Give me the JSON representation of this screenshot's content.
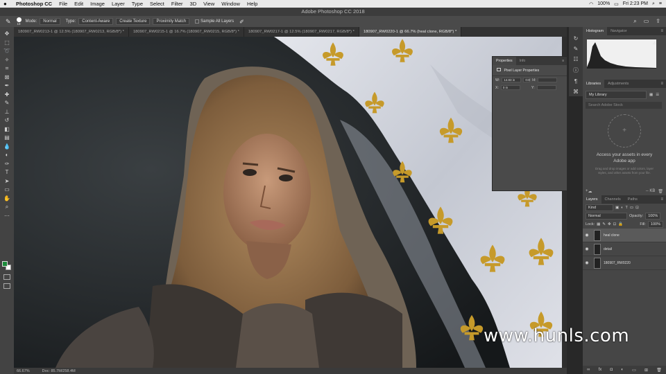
{
  "menubar": {
    "app": "Photoshop CC",
    "items": [
      "File",
      "Edit",
      "Image",
      "Layer",
      "Type",
      "Select",
      "Filter",
      "3D",
      "View",
      "Window",
      "Help"
    ],
    "battery": "100%",
    "clock": "Fri 2:23 PM"
  },
  "window_title": "Adobe Photoshop CC 2018",
  "options": {
    "brush_size": "19",
    "mode_label": "Mode:",
    "mode_value": "Normal",
    "type_label": "Type:",
    "type_buttons": [
      "Content-Aware",
      "Create Texture",
      "Proximity Match"
    ],
    "sample_all": "Sample All Layers"
  },
  "tabs": [
    {
      "label": "180907_RW0213-1 @ 12.5% (180907_RW0213, RGB/8*) *",
      "active": false
    },
    {
      "label": "180907_RW0215-1 @ 16.7% (180907_RW0215, RGB/8*) *",
      "active": false
    },
    {
      "label": "180907_RW0217-1 @ 12.5% (180907_RW0217, RGB/8*) *",
      "active": false
    },
    {
      "label": "180907_RW0220-1 @ 66.7% (heal clone, RGB/8*) *",
      "active": true
    }
  ],
  "status": {
    "zoom": "66.67%",
    "doc": "Doc: 85.7M/258.4M"
  },
  "properties": {
    "tabs": [
      "Properties",
      "Info"
    ],
    "subtitle": "Pixel Layer Properties",
    "w_label": "W:",
    "w_value": "14.83 in",
    "h_label": "H:",
    "x_label": "X:",
    "x_value": "0 in",
    "y_label": "Y:",
    "link": "GO"
  },
  "histogram_panel": {
    "tabs": [
      "Histogram",
      "Navigator"
    ]
  },
  "libraries": {
    "tabs": [
      "Libraries",
      "Adjustments"
    ],
    "library": "My Library",
    "search_placeholder": "Search Adobe Stock",
    "message": "Access your assets in every Adobe app",
    "hint": "Drag and drop images or add colors, layer styles, and other assets from your file.",
    "size": "-- KB"
  },
  "layers_panel": {
    "tabs": [
      "Layers",
      "Channels",
      "Paths"
    ],
    "kind": "Kind",
    "blend": "Normal",
    "opacity_label": "Opacity:",
    "opacity": "100%",
    "lock_label": "Lock:",
    "fill_label": "Fill:",
    "fill": "100%",
    "layers": [
      {
        "name": "heal clone",
        "active": true
      },
      {
        "name": "detail",
        "active": false
      },
      {
        "name": "180907_RW0220",
        "active": false
      }
    ]
  },
  "watermark": "www.hunls.com",
  "colors": {
    "foreground": "#1b8a3a",
    "background": "#ffffff"
  }
}
